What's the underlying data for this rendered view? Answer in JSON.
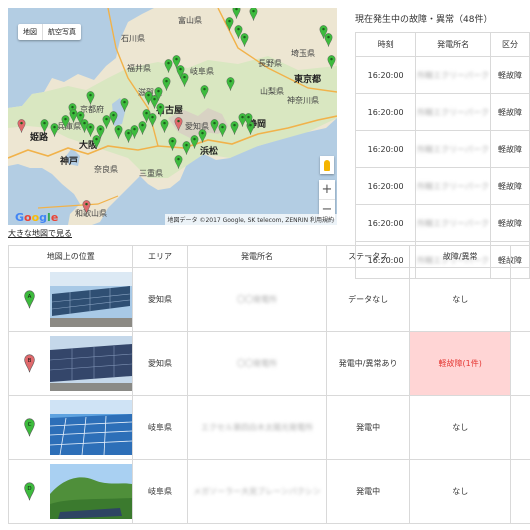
{
  "map": {
    "map_type_labels": [
      "地図",
      "航空写真"
    ],
    "cities": {
      "toyama": "富山県",
      "ishikawa": "石川県",
      "fukui": "福井県",
      "gifu": "岐阜県",
      "nagano": "長野県",
      "saitama": "埼玉県",
      "yamanashi": "山梨県",
      "tokyo": "東京都",
      "kanagawa": "神奈川県",
      "shiga": "滋賀県",
      "kyoto": "京都府",
      "hyogo": "兵庫県",
      "kobe": "神戸",
      "osaka": "大阪",
      "nara": "奈良県",
      "himeji": "姫路",
      "mie": "三重県",
      "nagoya": "名古屋",
      "aichi": "愛知県",
      "shizuoka": "静岡",
      "hamamatsu": "浜松",
      "wakayama": "和歌山県"
    },
    "google_logo": "Google",
    "attribution": "地図データ ©2017 Google, SK telecom, ZENRIN   利用規約",
    "big_map_link": "大きな地図で見る"
  },
  "alerts": {
    "title": "現在発生中の故障・異常（48件）",
    "headers": [
      "時刻",
      "発電所名",
      "区分"
    ],
    "rows": [
      {
        "time": "16:20:00",
        "station": "所轄エクリーパーク",
        "category": "軽故障"
      },
      {
        "time": "16:20:00",
        "station": "所轄エクリーパーク",
        "category": "軽故障"
      },
      {
        "time": "16:20:00",
        "station": "所轄エクリーパーク",
        "category": "軽故障"
      },
      {
        "time": "16:20:00",
        "station": "所轄エクリーパーク",
        "category": "軽故障"
      },
      {
        "time": "16:20:00",
        "station": "所轄エクリーパーク",
        "category": "軽故障"
      },
      {
        "time": "16:20:00",
        "station": "所轄エクリーパーク",
        "category": "軽故障"
      }
    ]
  },
  "plants": {
    "headers": [
      "地図上の位置",
      "エリア",
      "発電所名",
      "ステータス",
      "故障/異常"
    ],
    "rows": [
      {
        "marker": "A",
        "marker_color": "#3dbb3d",
        "area": "愛知県",
        "name": "〇〇発電所",
        "status": "データなし",
        "fault": "なし"
      },
      {
        "marker": "B",
        "marker_color": "#e0696c",
        "area": "愛知県",
        "name": "〇〇発電所",
        "status": "発電中/異常あり",
        "fault": "軽故障(1件)"
      },
      {
        "marker": "C",
        "marker_color": "#3dbb3d",
        "area": "岐阜県",
        "name": "エクセル第四白木太陽光発電所",
        "status": "発電中",
        "fault": "なし"
      },
      {
        "marker": "D",
        "marker_color": "#3dbb3d",
        "area": "岐阜県",
        "name": "メガソーラー大見ブレーンパクシン",
        "status": "発電中",
        "fault": "なし"
      }
    ]
  },
  "colors": {
    "green_pin": "#3dbb3d",
    "red_pin": "#e0696c",
    "alarm_bg": "#ffd5d5",
    "alarm_text": "#e53935"
  }
}
